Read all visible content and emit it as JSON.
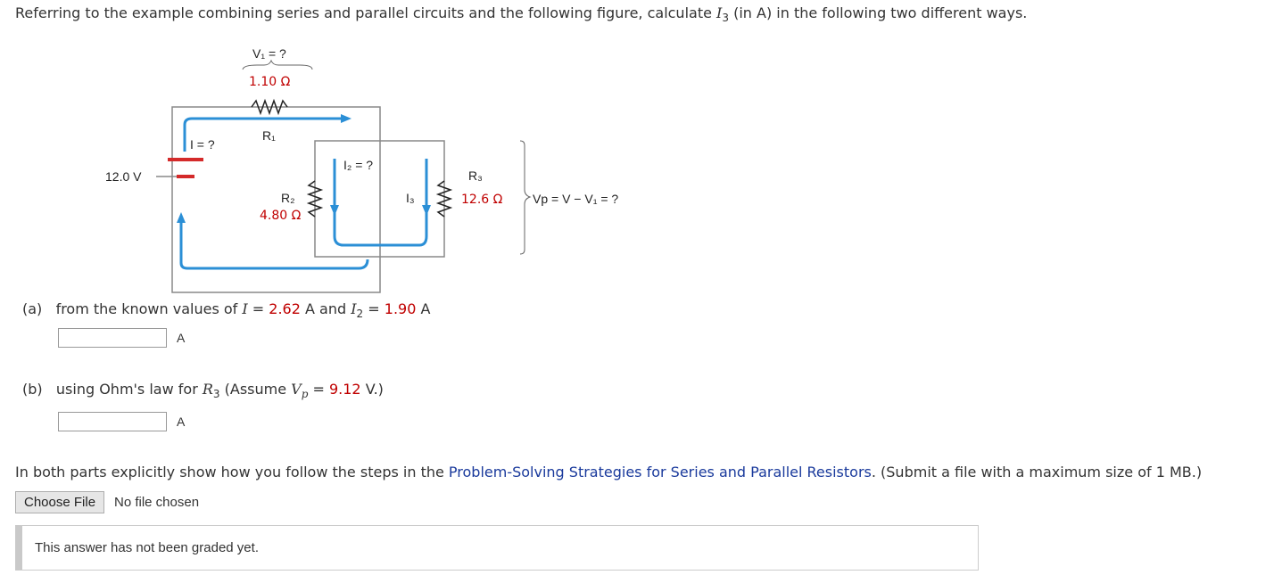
{
  "question": {
    "intro_before": "Referring to the example combining series and parallel circuits and the following figure, calculate ",
    "intro_var": "I",
    "intro_sub": "3",
    "intro_after": " (in A) in the following two different ways."
  },
  "figure": {
    "v1_label": "V₁ = ?",
    "r1_value": "1.10 Ω",
    "r1_label": "R₁",
    "i_label": "I = ?",
    "source_label": "12.0 V",
    "i2_label": "I₂ = ?",
    "r2_label": "R₂",
    "r2_value": "4.80 Ω",
    "i3_label": "I₃",
    "r3_label": "R₃",
    "r3_value": "12.6 Ω",
    "vp_label": "Vp = V − V₁ = ?"
  },
  "part_a": {
    "tag": "(a)",
    "text1": "from the known values of ",
    "var_i": "I",
    "eq": " = ",
    "val_i": "2.62",
    "unit_a1": " A and ",
    "var_i2": "I",
    "sub_2": "2",
    "eq2": " = ",
    "val_i2": "1.90",
    "unit_a2": " A",
    "input_value": "",
    "unit": "A"
  },
  "part_b": {
    "tag": "(b)",
    "text1": "using Ohm's law for ",
    "var_r": "R",
    "sub_3": "3",
    "text2": " (Assume ",
    "var_v": "V",
    "sub_p": "p",
    "eq": " = ",
    "val_vp": "9.12",
    "text3": " V.)",
    "input_value": "",
    "unit": "A"
  },
  "instructions": {
    "before": "In both parts explicitly show how you follow the steps in the ",
    "link": "Problem-Solving Strategies for Series and Parallel Resistors",
    "after": ". (Submit a file with a maximum size of 1 MB.)"
  },
  "file_upload": {
    "button_label": "Choose File",
    "status": "No file chosen"
  },
  "grading": {
    "status": "This answer has not been graded yet."
  },
  "colors": {
    "value_red": "#c00000",
    "link_blue": "#1a3a9c",
    "circuit_blue": "#2b8fd6",
    "battery_red": "#d42a2a"
  }
}
